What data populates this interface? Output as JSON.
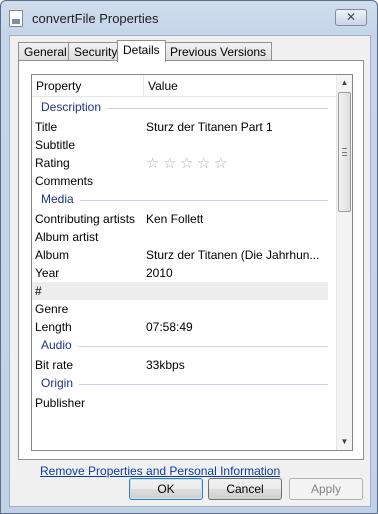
{
  "window": {
    "title": "convertFile Properties",
    "close_glyph": "✕"
  },
  "tabs": [
    {
      "label": "General",
      "active": false
    },
    {
      "label": "Security",
      "active": false
    },
    {
      "label": "Details",
      "active": true
    },
    {
      "label": "Previous Versions",
      "active": false
    }
  ],
  "list": {
    "columns": {
      "property": "Property",
      "value": "Value"
    },
    "groups": {
      "description": "Description",
      "media": "Media",
      "audio": "Audio",
      "origin": "Origin"
    },
    "rows": {
      "title": {
        "property": "Title",
        "value": "Sturz der Titanen Part 1"
      },
      "subtitle": {
        "property": "Subtitle",
        "value": ""
      },
      "rating": {
        "property": "Rating",
        "stars": 0,
        "star_glyph": "☆"
      },
      "comments": {
        "property": "Comments",
        "value": ""
      },
      "contributing_artists": {
        "property": "Contributing artists",
        "value": "Ken Follett"
      },
      "album_artist": {
        "property": "Album artist",
        "value": ""
      },
      "album": {
        "property": "Album",
        "value": "Sturz der Titanen (Die Jahrhun..."
      },
      "year": {
        "property": "Year",
        "value": "2010"
      },
      "track": {
        "property": "#",
        "value": ""
      },
      "genre": {
        "property": "Genre",
        "value": ""
      },
      "length": {
        "property": "Length",
        "value": "07:58:49"
      },
      "bit_rate": {
        "property": "Bit rate",
        "value": "33kbps"
      },
      "publisher": {
        "property": "Publisher",
        "value": ""
      }
    }
  },
  "scrollbar": {
    "up": "▲",
    "down": "▼"
  },
  "remove_link": "Remove Properties and Personal Information",
  "buttons": {
    "ok": "OK",
    "cancel": "Cancel",
    "apply": "Apply"
  }
}
